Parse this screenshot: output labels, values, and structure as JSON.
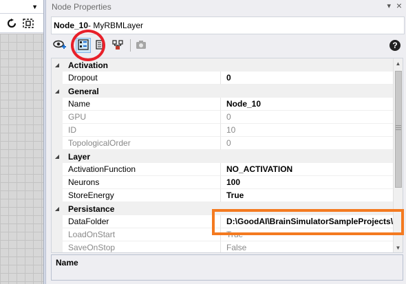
{
  "left_pane": {
    "dropdown_glyph": "▼",
    "toolbar_icons": [
      "refresh-icon",
      "scan-icon"
    ]
  },
  "panel": {
    "title": "Node Properties",
    "pin_glyph": "▾",
    "close_glyph": "×",
    "node_name": "Node_10",
    "node_type": " - MyRBMLayer"
  },
  "toolbar": {
    "buttons": [
      "view-add-icon",
      "properties-icon",
      "export-icon",
      "network-icon",
      "camera-icon"
    ],
    "help_glyph": "?"
  },
  "grid": {
    "categories": [
      {
        "name": "Activation",
        "properties": [
          {
            "name": "Dropout",
            "value": "0",
            "readonly": false,
            "bold": true
          }
        ]
      },
      {
        "name": "General",
        "properties": [
          {
            "name": "Name",
            "value": "Node_10",
            "readonly": false,
            "bold": true
          },
          {
            "name": "GPU",
            "value": "0",
            "readonly": true,
            "bold": false
          },
          {
            "name": "ID",
            "value": "10",
            "readonly": true,
            "bold": false
          },
          {
            "name": "TopologicalOrder",
            "value": "0",
            "readonly": true,
            "bold": false
          }
        ]
      },
      {
        "name": "Layer",
        "properties": [
          {
            "name": "ActivationFunction",
            "value": "NO_ACTIVATION",
            "readonly": false,
            "bold": true
          },
          {
            "name": "Neurons",
            "value": "100",
            "readonly": false,
            "bold": true
          },
          {
            "name": "StoreEnergy",
            "value": "True",
            "readonly": false,
            "bold": true
          }
        ]
      },
      {
        "name": "Persistance",
        "properties": [
          {
            "name": "DataFolder",
            "value": "D:\\GoodAI\\BrainSimulatorSampleProjects\\F",
            "readonly": false,
            "bold": true
          },
          {
            "name": "LoadOnStart",
            "value": "True",
            "readonly": true,
            "bold": false
          },
          {
            "name": "SaveOnStop",
            "value": "False",
            "readonly": true,
            "bold": false
          }
        ]
      }
    ]
  },
  "description": {
    "title": "Name"
  },
  "colors": {
    "highlight_circle": "#e8202a",
    "highlight_box": "#f47a20",
    "selected_button_bg": "#cde6f7"
  }
}
